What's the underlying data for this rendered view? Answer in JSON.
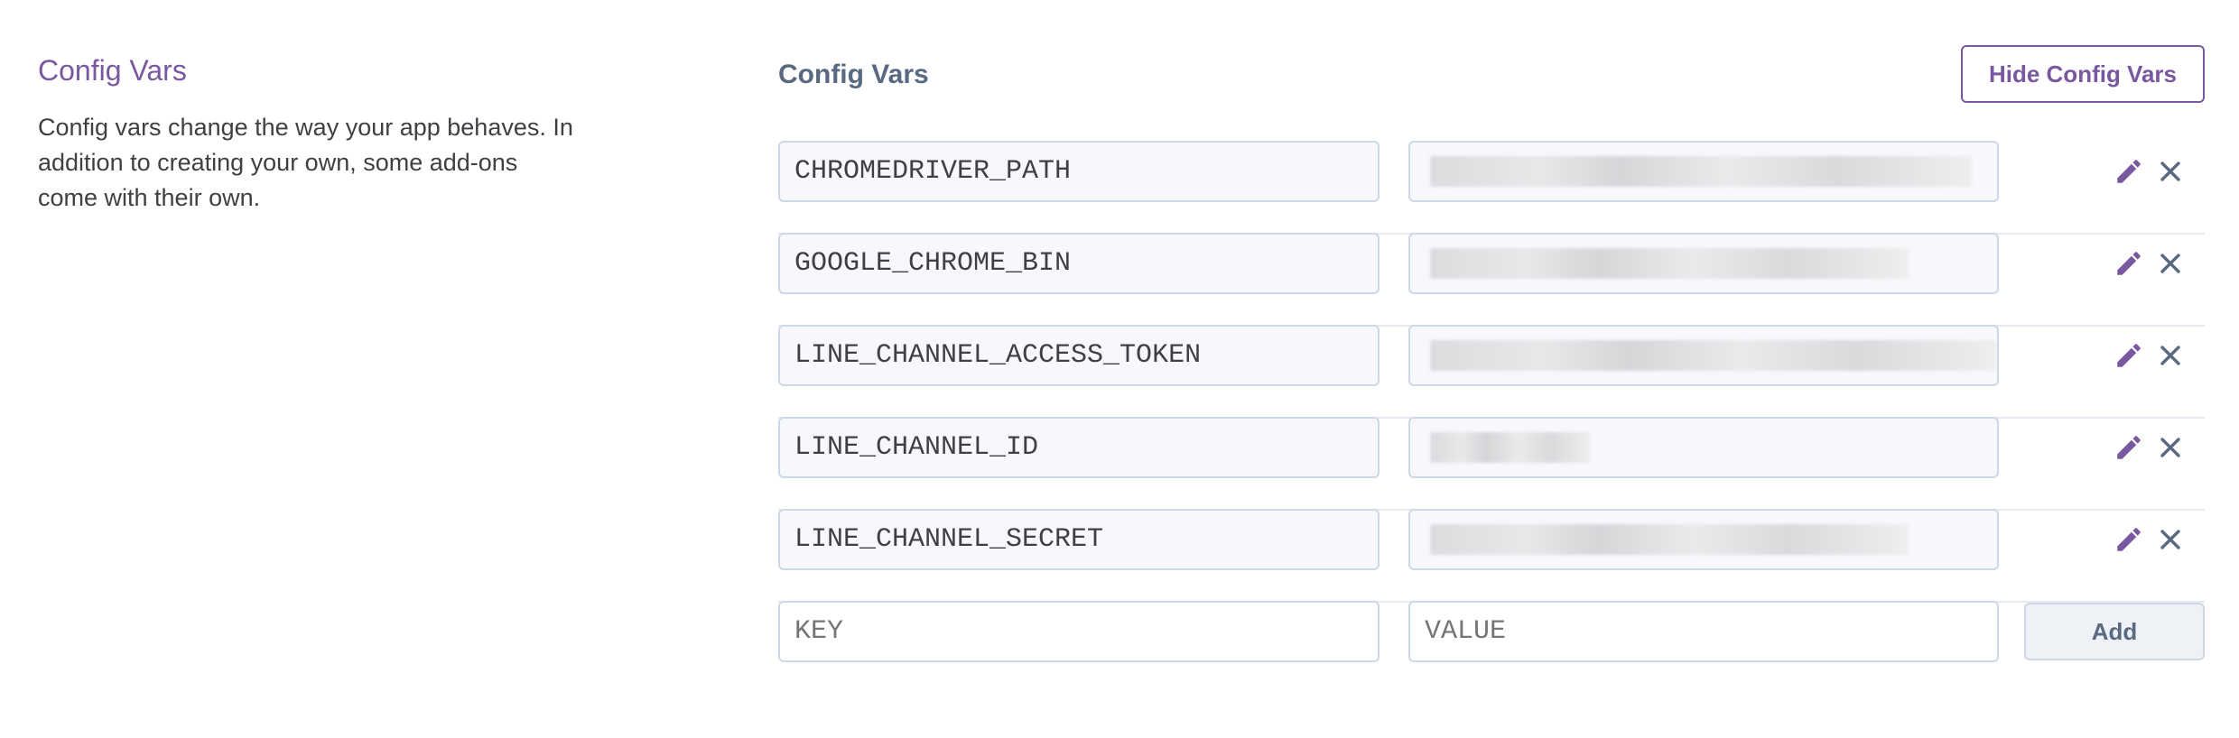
{
  "sidebar": {
    "title": "Config Vars",
    "description": "Config vars change the way your app behaves. In addition to creating your own, some add-ons come with their own."
  },
  "main": {
    "title": "Config Vars",
    "hide_button": "Hide Config Vars",
    "vars": [
      {
        "key": "CHROMEDRIVER_PATH",
        "value_hidden": true
      },
      {
        "key": "GOOGLE_CHROME_BIN",
        "value_hidden": true
      },
      {
        "key": "LINE_CHANNEL_ACCESS_TOKEN",
        "value_hidden": true
      },
      {
        "key": "LINE_CHANNEL_ID",
        "value_hidden": true
      },
      {
        "key": "LINE_CHANNEL_SECRET",
        "value_hidden": true
      }
    ],
    "new_var": {
      "key_placeholder": "KEY",
      "value_placeholder": "VALUE",
      "add_label": "Add"
    }
  },
  "icons": {
    "edit": "pencil-icon",
    "delete": "close-icon"
  },
  "colors": {
    "accent": "#79589f",
    "muted": "#596981",
    "border": "#cfd7e6"
  }
}
